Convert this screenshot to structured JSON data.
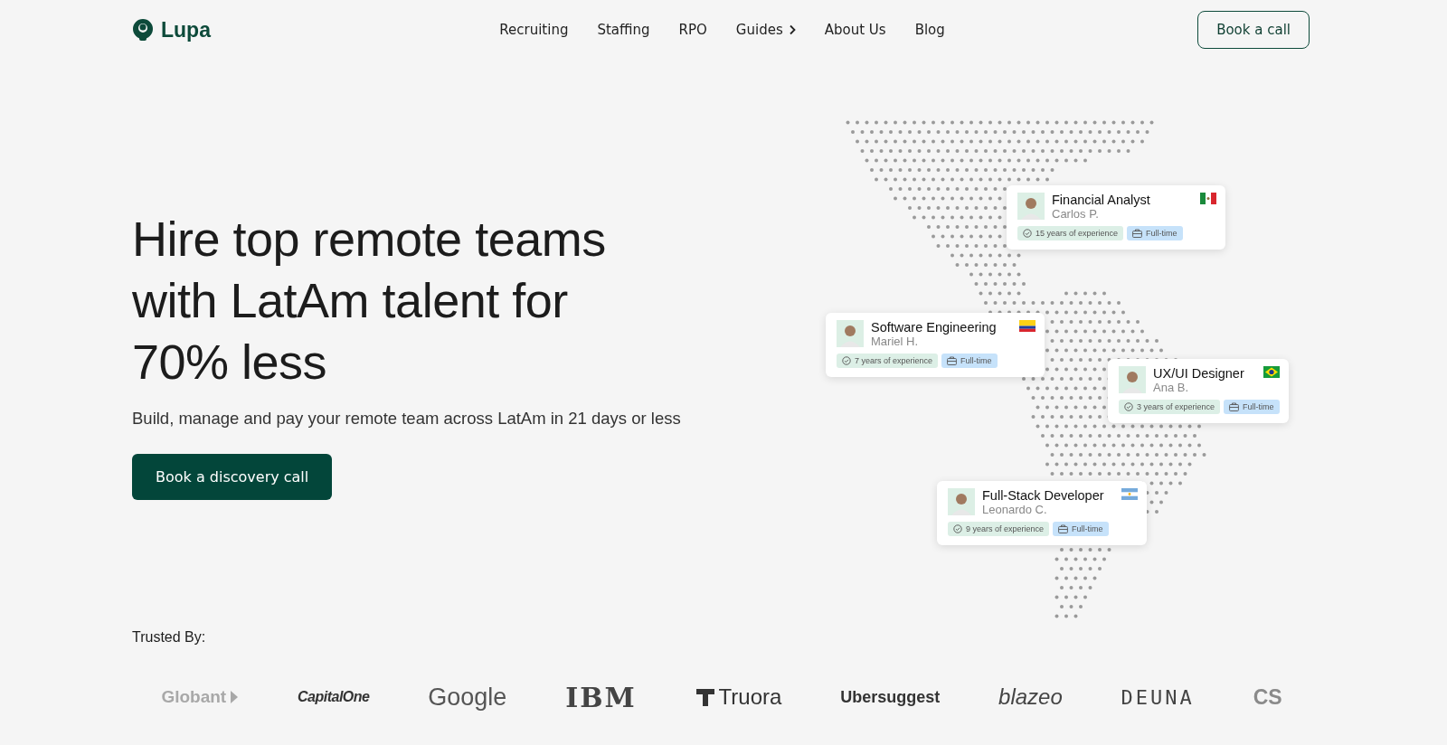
{
  "header": {
    "logo": "Lupa",
    "nav": [
      {
        "label": "Recruiting",
        "has_menu": false
      },
      {
        "label": "Staffing",
        "has_menu": false
      },
      {
        "label": "RPO",
        "has_menu": false
      },
      {
        "label": "Guides",
        "has_menu": true
      },
      {
        "label": "About Us",
        "has_menu": false
      },
      {
        "label": "Blog",
        "has_menu": false
      }
    ],
    "cta": "Book a call"
  },
  "hero": {
    "title": "Hire top remote teams with LatAm talent for 70% less",
    "subtitle": "Build, manage and pay your remote team across LatAm in 21 days or less",
    "cta": "Book a discovery call"
  },
  "talent_cards": [
    {
      "role": "Financial Analyst",
      "name": "Carlos P.",
      "kind": "mexico",
      "experience": "15 years of experience",
      "type": "Full-time"
    },
    {
      "role": "Software Engineering",
      "name": "Mariel H.",
      "kind": "colombia",
      "experience": "7 years of experience",
      "type": "Full-time"
    },
    {
      "role": "UX/UI Designer",
      "name": "Ana B.",
      "kind": "brazil",
      "experience": "3 years of experience",
      "type": "Full-time"
    },
    {
      "role": "Full-Stack Developer",
      "name": "Leonardo C.",
      "kind": "argentina",
      "experience": "9 years of experience",
      "type": "Full-time"
    }
  ],
  "trusted": {
    "label": "Trusted By:",
    "logos": [
      {
        "text": "Globant",
        "kind": "globant"
      },
      {
        "text": "CapitalOne",
        "kind": "capitalone"
      },
      {
        "text": "Google",
        "kind": "google"
      },
      {
        "text": "IBM",
        "kind": "ibm"
      },
      {
        "text": "Truora",
        "kind": "truora"
      },
      {
        "text": "Ubersuggest",
        "kind": "ubersuggest"
      },
      {
        "text": "blazeo",
        "kind": "blazeo"
      },
      {
        "text": "DEUNA",
        "kind": "deuna"
      },
      {
        "text": "CS",
        "kind": "cut"
      }
    ]
  }
}
